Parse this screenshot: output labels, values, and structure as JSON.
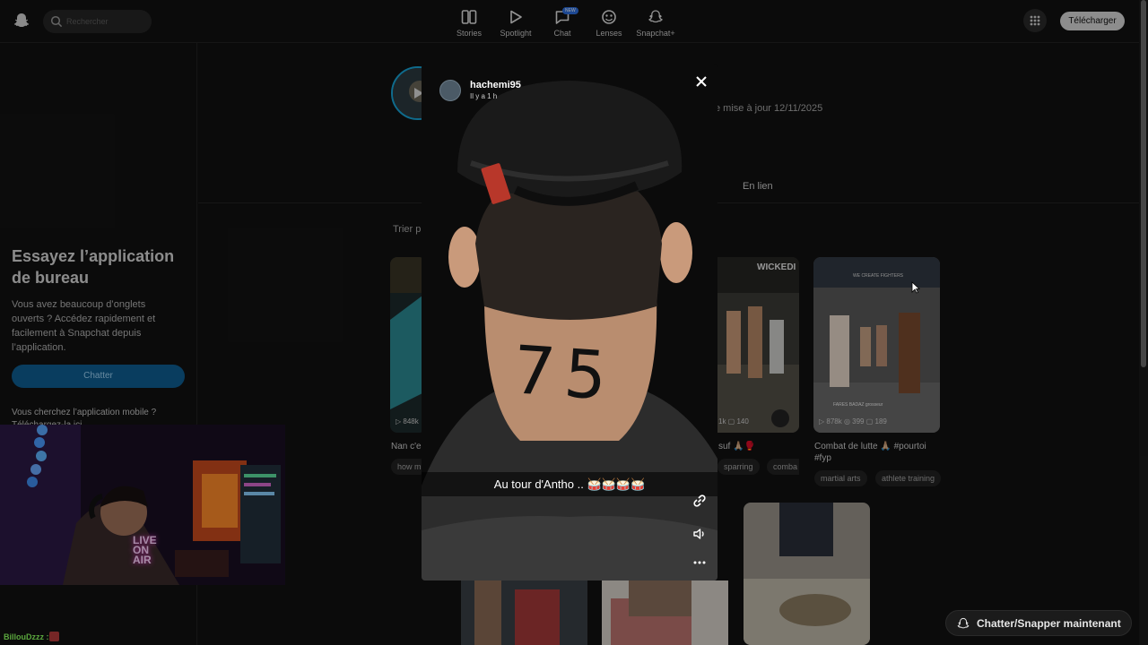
{
  "topbar": {
    "search_placeholder": "Rechercher",
    "nav": [
      {
        "label": "Stories",
        "icon": "stories-icon"
      },
      {
        "label": "Spotlight",
        "icon": "spotlight-icon"
      },
      {
        "label": "Chat",
        "icon": "chat-icon",
        "badge": "NEW"
      },
      {
        "label": "Lenses",
        "icon": "lenses-icon"
      },
      {
        "label": "Snapchat+",
        "icon": "snapchat-plus-icon"
      }
    ],
    "download_label": "Télécharger"
  },
  "sidebar": {
    "promo_title": "Essayez l’application de bureau",
    "promo_text": "Vous avez beaucoup d’onglets ouverts ? Accédez rapidement et facilement à Snapchat depuis l’application.",
    "chat_button": "Chatter",
    "promo_text2": "Vous cherchez l’application mobile ? Téléchargez-la ici"
  },
  "stream_overlay": {
    "chat_user": "BillouDzzz :",
    "webcam_sign": "LIVE ON AIR"
  },
  "profile": {
    "updated": "e mise à jour 12/11/2025",
    "tab_link": "En lien",
    "sort_label": "Trier p"
  },
  "grid": {
    "cards": [
      {
        "stats": "▷ 848k",
        "caption": "Nan c'es",
        "tags": [
          "how m"
        ]
      },
      {
        "stats": "1k  ▢ 140",
        "caption": "suf 🙏🏼🥊",
        "tags": [
          "sparring",
          "comba"
        ]
      },
      {
        "stats": "▷ 878k  ◎ 399  ▢ 189",
        "caption": "Combat de lutte 🙏🏼 #pourtoi #fyp",
        "tags": [
          "martial arts",
          "athlete training"
        ]
      }
    ],
    "thumb_caption_card3": "FARES BADAZ grosseur",
    "thumb_banner_card2": "WICKEDI",
    "thumb_banner_card3": "WE CREATE FIGHTERS"
  },
  "modal": {
    "username": "hachemi95",
    "time": "Il y a 1 h",
    "caption": "Au tour d'Antho .. 🥁🥁🥁🥁",
    "neck_text": "75"
  },
  "cta": {
    "label": "Chatter/Snapper maintenant"
  },
  "colors": {
    "accent_blue": "#0e5f93",
    "ring_blue": "#18a5d8",
    "chat_green": "#8aff5e"
  }
}
